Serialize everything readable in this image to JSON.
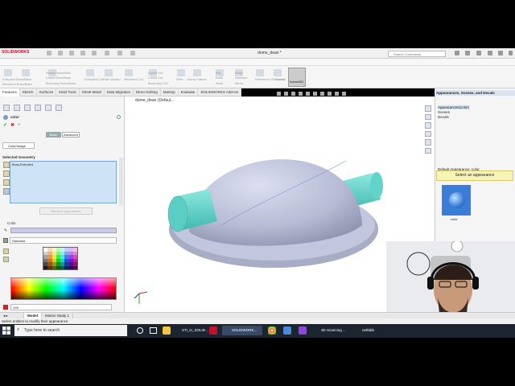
{
  "app": {
    "logo": "SOLIDWORKS",
    "document_title": "dome_dean *",
    "search_placeholder": "Search Commands"
  },
  "ribbon": {
    "groups": [
      "Extruded Boss/Base",
      "Revolved Boss/Base",
      "Swept Boss/Base",
      "Lofted Boss/Base",
      "Boundary Boss/Base",
      "Extruded Cut",
      "Hole Wizard",
      "Revolved Cut",
      "Swept Cut",
      "Lofted Cut",
      "Boundary Cut",
      "Fillet",
      "Linear Pattern",
      "Rib",
      "Draft",
      "Shell",
      "Wrap",
      "Intersect",
      "Mirror",
      "Reference Geometry",
      "Curves"
    ],
    "instant3d_label": "Instant3D"
  },
  "tabs": [
    "Features",
    "Sketch",
    "Surfaces",
    "Mold Tools",
    "Sheet Metal",
    "Data Migration",
    "Direct Editing",
    "Markup",
    "Evaluate",
    "SOLIDWORKS Add-Ins"
  ],
  "feature_tree": {
    "root_label": "dome_dean (Defaul..."
  },
  "property_manager": {
    "title": "color",
    "mode_buttons": [
      "Basic",
      "Advanced"
    ],
    "color_image_tab": "Color/Image",
    "selected_geometry_header": "Selected Geometry",
    "selected_item": "Boss-Extrude4",
    "remove_button": "Remove appearance",
    "color_header": "Color",
    "color_mode": "Standard",
    "rgb_value": "128"
  },
  "appearances_panel": {
    "title": "Appearances, Scenes, and Decals",
    "tree_items": [
      "Appearances(color)",
      "Scenes",
      "Decals"
    ],
    "default_appearance_label": "Default Appearance: color",
    "tooltip": "Select an appearance",
    "thumbnail_label": "color"
  },
  "bottom_tabs": [
    "Model",
    "Motion Study 1"
  ],
  "status": "Select entities to modify their appearance",
  "taskbar": {
    "search_placeholder": "Type here to search",
    "tasks": [
      "STI_in_SOLID...",
      "SOLIDWORK...",
      "3D Scanning ...",
      "netfabb"
    ]
  },
  "colors": {
    "dome": "#b7bbd4",
    "cylinder": "#5fd5cc",
    "accent": "#3a7dd8",
    "taskbar": "#1c2430"
  }
}
